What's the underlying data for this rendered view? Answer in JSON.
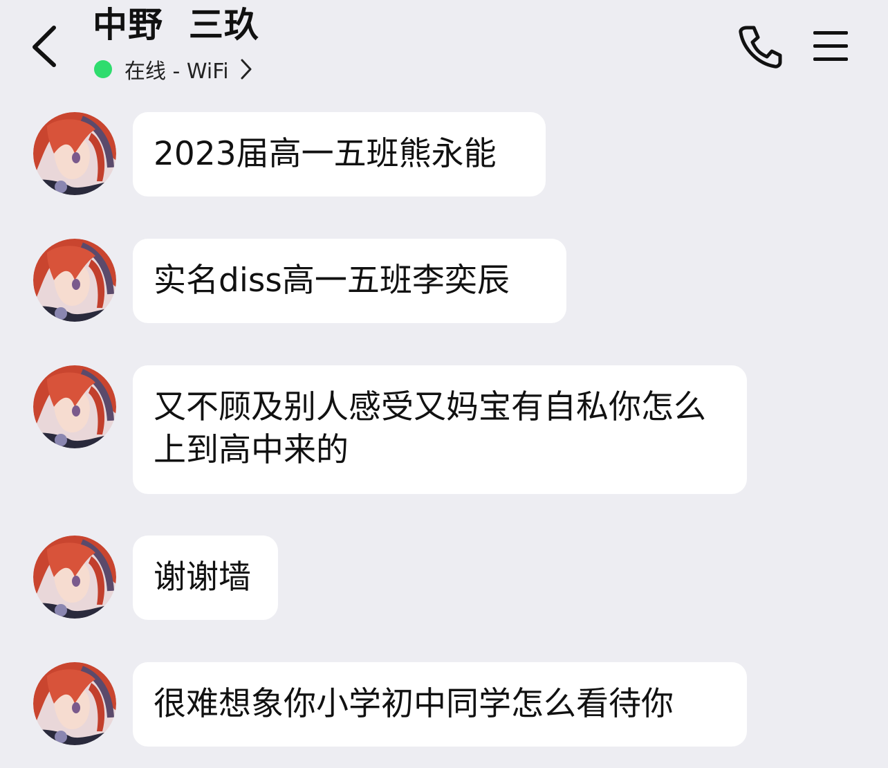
{
  "header": {
    "contact_name": "中野  三玖",
    "status_text": "在线 - WiFi",
    "status_color": "#2fdc6e",
    "icons": {
      "back": "back-chevron-icon",
      "phone": "phone-icon",
      "menu": "menu-icon",
      "status_chevron": "chevron-right-icon"
    }
  },
  "messages": [
    {
      "sender": "中野  三玖",
      "text": "2023届高一五班熊永能"
    },
    {
      "sender": "中野  三玖",
      "text": "实名diss高一五班李奕辰"
    },
    {
      "sender": "中野  三玖",
      "text": "又不顾及别人感受又妈宝有自私你怎么上到高中来的"
    },
    {
      "sender": "中野  三玖",
      "text": "谢谢墙"
    },
    {
      "sender": "中野  三玖",
      "text": "很难想象你小学初中同学怎么看待你"
    }
  ],
  "colors": {
    "background": "#ededf2",
    "bubble": "#ffffff",
    "text": "#111111"
  }
}
